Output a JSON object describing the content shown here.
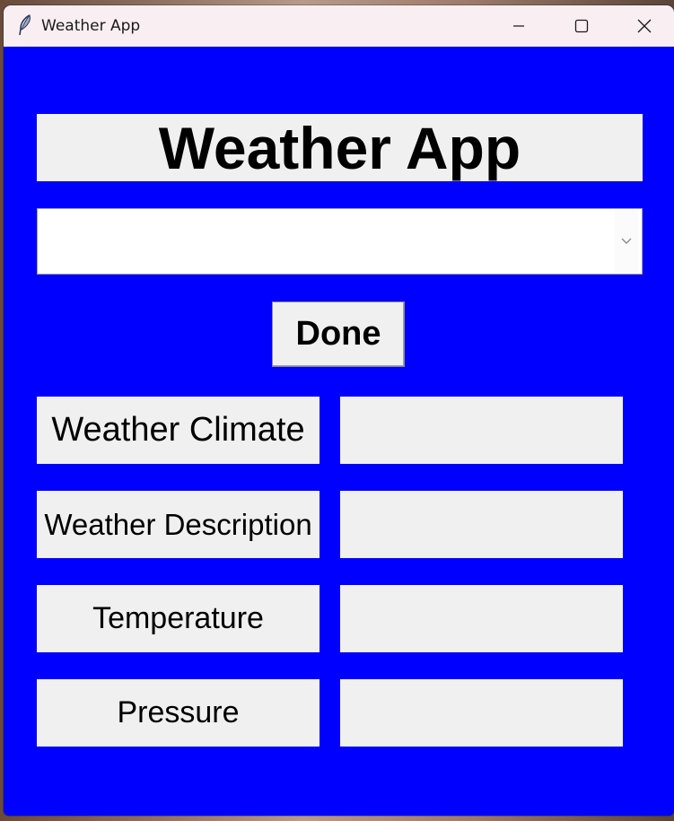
{
  "window": {
    "title": "Weather App",
    "background_color": "#0000ff",
    "titlebar_color": "#f9eff3"
  },
  "icons": {
    "app": "feather-icon",
    "minimize": "minimize-icon",
    "maximize": "maximize-icon",
    "close": "close-icon",
    "dropdown": "chevron-down-icon"
  },
  "main": {
    "heading": "Weather App",
    "city_select": {
      "value": ""
    },
    "done_label": "Done",
    "fields": [
      {
        "label": "Weather Climate",
        "value": ""
      },
      {
        "label": "Weather Description",
        "value": ""
      },
      {
        "label": "Temperature",
        "value": ""
      },
      {
        "label": "Pressure",
        "value": ""
      }
    ]
  }
}
